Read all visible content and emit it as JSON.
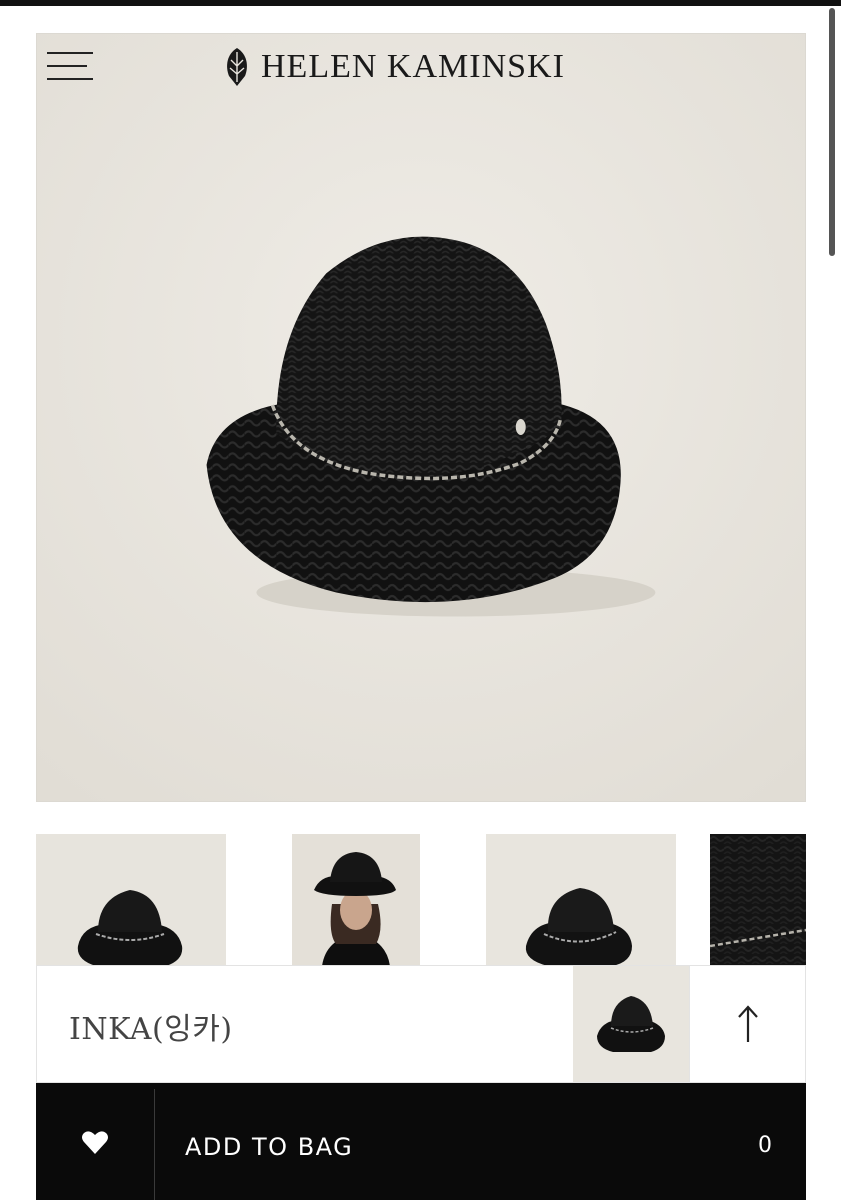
{
  "header": {
    "brand": "HELEN KAMINSKI",
    "menu_icon": "hamburger-menu-icon",
    "logo_icon": "palm-leaf-logo-icon"
  },
  "gallery": {
    "main_image": "black straw bucket hat with chain band",
    "thumbnails": [
      "black hat front view",
      "model wearing black hat",
      "black hat angled view",
      "woven straw and chain close-up"
    ]
  },
  "product": {
    "name": "INKA(잉카)",
    "scroll_top_icon": "arrow-up-icon"
  },
  "actions": {
    "wishlist_icon": "heart-icon",
    "add_to_bag_label": "ADD TO BAG",
    "bag_count": "0"
  },
  "colors": {
    "cta_background": "#0a0a0a",
    "hero_background": "#e9e6df"
  }
}
